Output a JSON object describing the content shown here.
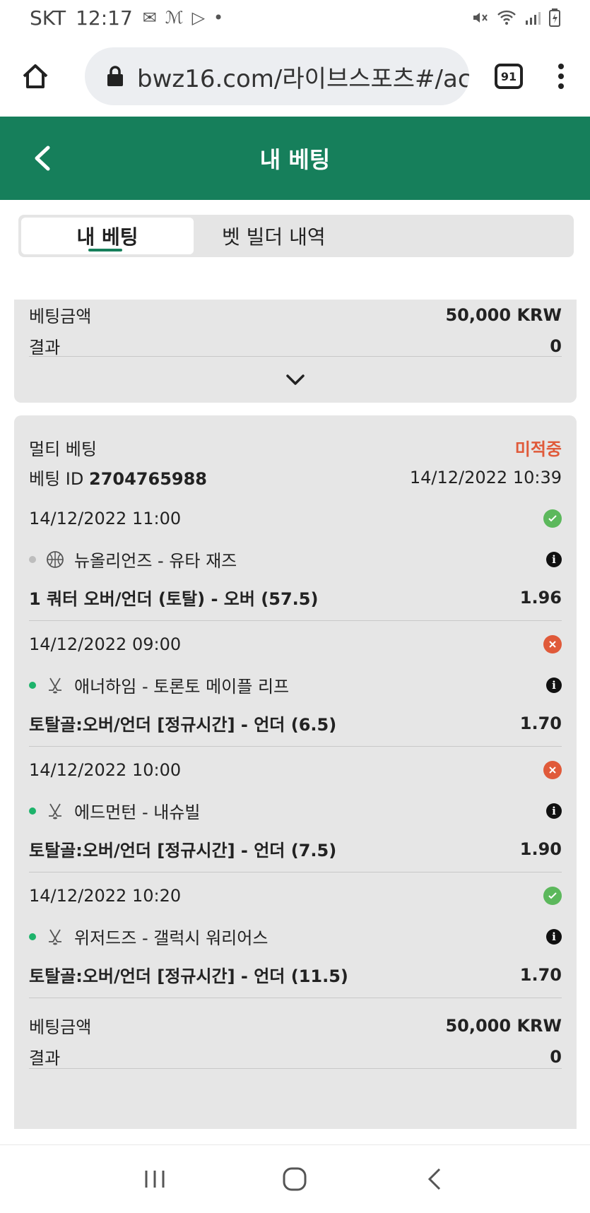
{
  "status_bar": {
    "carrier": "SKT",
    "time": "12:17"
  },
  "browser": {
    "url": "bwz16.com/라이브스포츠#/ac",
    "tab_count": "91"
  },
  "header": {
    "title": "내 베팅"
  },
  "tabs": [
    {
      "label": "내 베팅"
    },
    {
      "label": "벳 빌더 내역"
    }
  ],
  "prev_bet": {
    "amount_label": "베팅금액",
    "amount_value": "50,000 KRW",
    "result_label": "결과",
    "result_value": "0"
  },
  "bet": {
    "type": "멀티 베팅",
    "status": "미적중",
    "id_label": "베팅 ID",
    "id_value": "2704765988",
    "placed_at": "14/12/2022 10:39",
    "selections": [
      {
        "date": "14/12/2022 11:00",
        "teams": "뉴올리언즈 - 유타 재즈",
        "market": "1 쿼터 오버/언더 (토탈) - 오버 (57.5)",
        "odds": "1.96",
        "result": "win",
        "live_dot": "grey",
        "sport": "basketball-icon"
      },
      {
        "date": "14/12/2022 09:00",
        "teams": "애너하임 - 토론토 메이플 리프",
        "market": "토탈골:오버/언더 [정규시간] - 언더 (6.5)",
        "odds": "1.70",
        "result": "lose",
        "live_dot": "green",
        "sport": "hockey-icon"
      },
      {
        "date": "14/12/2022 10:00",
        "teams": "에드먼턴 - 내슈빌",
        "market": "토탈골:오버/언더 [정규시간] - 언더 (7.5)",
        "odds": "1.90",
        "result": "lose",
        "live_dot": "green",
        "sport": "hockey-icon"
      },
      {
        "date": "14/12/2022 10:20",
        "teams": "위저드즈 - 갤럭시 워리어스",
        "market": "토탈골:오버/언더 [정규시간] - 언더 (11.5)",
        "odds": "1.70",
        "result": "win",
        "live_dot": "green",
        "sport": "hockey-icon"
      }
    ],
    "amount_label": "베팅금액",
    "amount_value": "50,000 KRW",
    "result_label": "결과",
    "result_value": "0"
  },
  "colors": {
    "brand_green": "#167f5b",
    "lost_red": "#e05a3a",
    "win_green": "#5cb85c"
  }
}
